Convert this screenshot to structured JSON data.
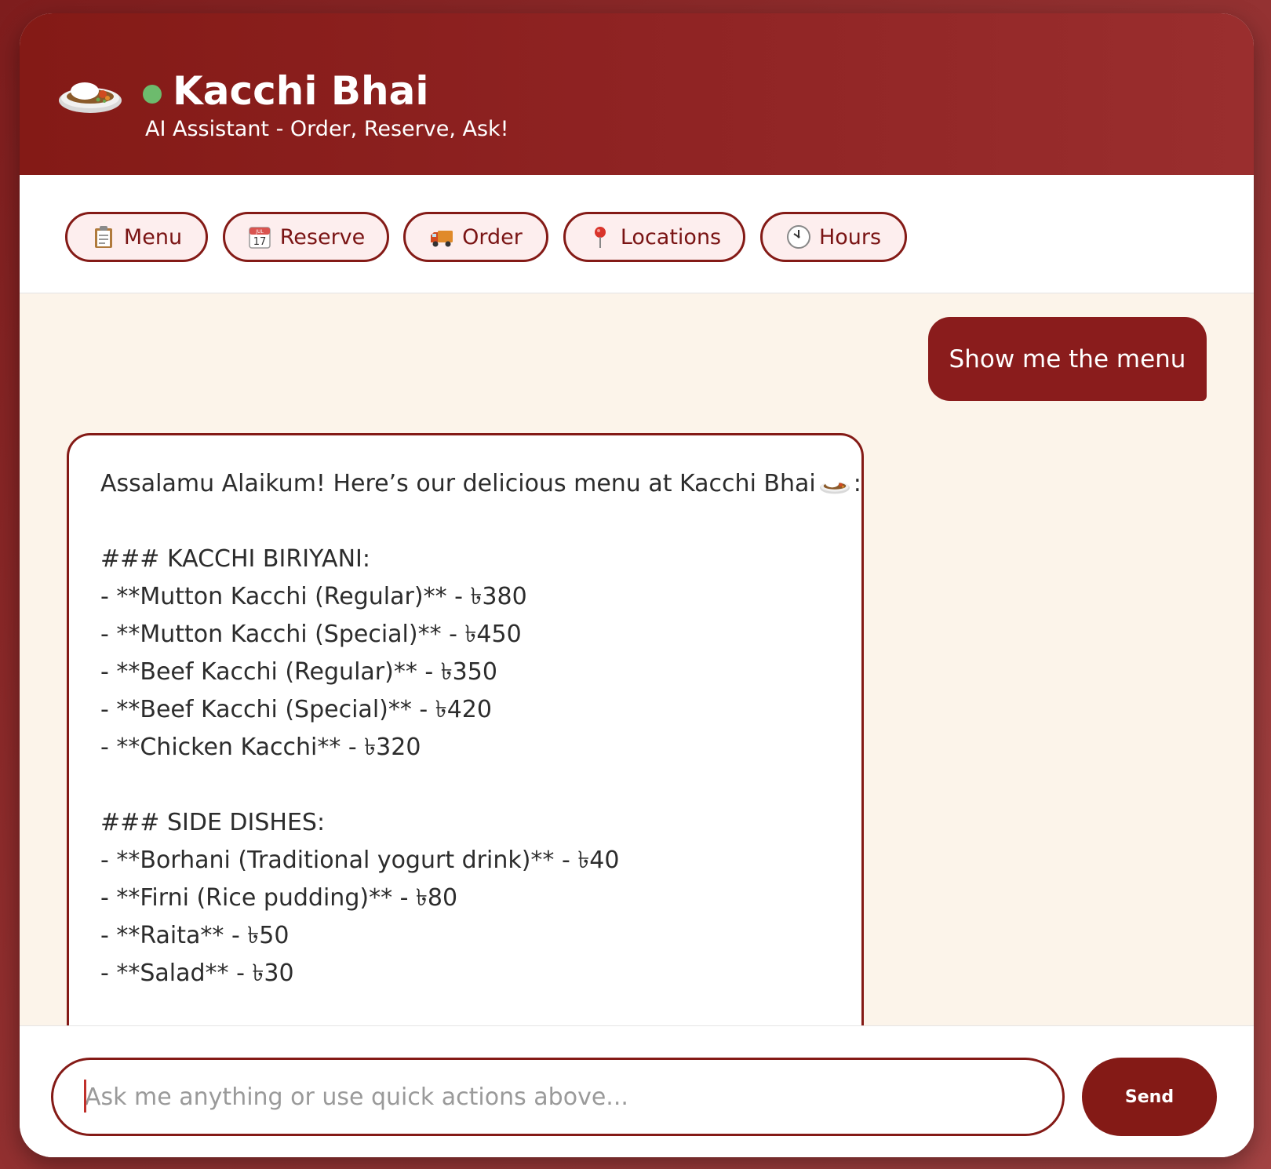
{
  "header": {
    "title": "Kacchi Bhai",
    "subtitle": "AI Assistant - Order, Reserve, Ask!",
    "logo_icon": "rice-plate-icon",
    "status_color": "#6dbb6d"
  },
  "quick_actions": [
    {
      "label": "Menu",
      "icon": "clipboard-icon"
    },
    {
      "label": "Reserve",
      "icon": "calendar-icon",
      "icon_text_top": "JUL",
      "icon_text_day": "17"
    },
    {
      "label": "Order",
      "icon": "delivery-truck-icon"
    },
    {
      "label": "Locations",
      "icon": "map-pin-icon"
    },
    {
      "label": "Hours",
      "icon": "clock-icon"
    }
  ],
  "chat": {
    "user_message": "Show me the menu",
    "bot_intro": "Assalamu Alaikum! Here’s our delicious menu at Kacchi Bhai",
    "bot_intro_suffix": ":",
    "bot_lines": [
      "",
      "### KACCHI BIRIYANI:",
      "- **Mutton Kacchi (Regular)** - ৳380",
      "- **Mutton Kacchi (Special)** - ৳450",
      "- **Beef Kacchi (Regular)** - ৳350",
      "- **Beef Kacchi (Special)** - ৳420",
      "- **Chicken Kacchi** - ৳320",
      "",
      "### SIDE DISHES:",
      "- **Borhani (Traditional yogurt drink)** - ৳40",
      "- **Firni (Rice pudding)** - ৳80",
      "- **Raita** - ৳50",
      "- **Salad** - ৳30"
    ]
  },
  "input": {
    "placeholder": "Ask me anything or use quick actions above...",
    "value": ""
  },
  "send_label": "Send",
  "colors": {
    "brand": "#841a16",
    "chat_bg": "#fcf4ea",
    "button_bg": "#fdeeee"
  }
}
